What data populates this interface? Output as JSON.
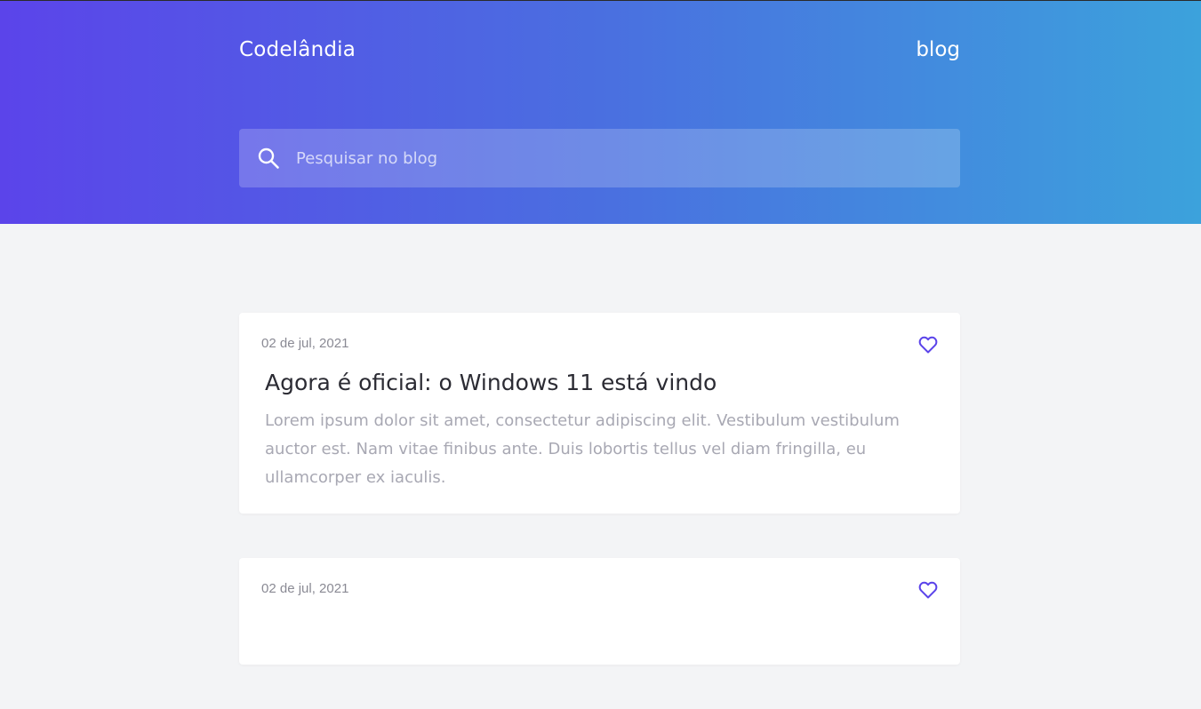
{
  "header": {
    "brand": "Codelândia",
    "nav_link": "blog"
  },
  "search": {
    "placeholder": "Pesquisar no blog",
    "icon": "search-icon"
  },
  "colors": {
    "gradient_start": "#5b44ea",
    "gradient_end": "#3ca2dc",
    "accent": "#5b44ea",
    "page_background": "#f3f4f6"
  },
  "posts": [
    {
      "date": "02 de jul, 2021",
      "title": "Agora é oficial: o Windows 11 está vindo",
      "excerpt": "Lorem ipsum dolor sit amet, consectetur adipiscing elit. Vestibulum vestibulum auctor est. Nam vitae finibus ante. Duis lobortis tellus vel diam fringilla, eu ullamcorper ex iaculis.",
      "icon": "heart-icon"
    },
    {
      "date": "02 de jul, 2021",
      "icon": "heart-icon"
    }
  ]
}
